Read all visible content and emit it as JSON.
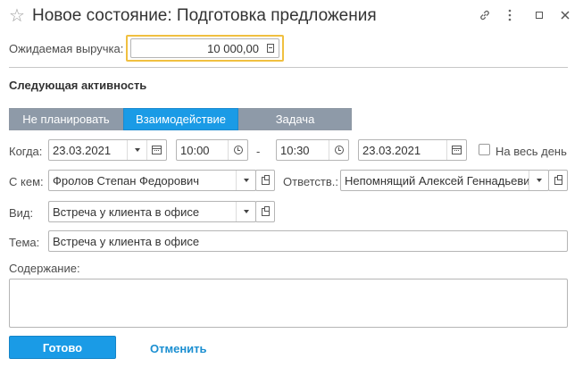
{
  "window": {
    "title": "Новое состояние: Подготовка предложения"
  },
  "revenue": {
    "label": "Ожидаемая выручка:",
    "value": "10 000,00"
  },
  "section": {
    "title": "Следующая активность"
  },
  "activity_tabs": [
    {
      "label": "Не планировать",
      "selected": false
    },
    {
      "label": "Взаимодействие",
      "selected": true
    },
    {
      "label": "Задача",
      "selected": false
    }
  ],
  "when": {
    "label": "Когда:",
    "start_date": "23.03.2021",
    "start_time": "10:00",
    "dash": "-",
    "end_time": "10:30",
    "end_date": "23.03.2021",
    "all_day_label": "На весь день",
    "all_day_checked": false
  },
  "with": {
    "label": "С кем:",
    "value": "Фролов Степан Федорович"
  },
  "responsible": {
    "label": "Ответств.:",
    "value": "Непомнящий Алексей Геннадьевич"
  },
  "kind": {
    "label": "Вид:",
    "value": "Встреча у клиента в офисе"
  },
  "subject": {
    "label": "Тема:",
    "value": "Встреча у клиента в офисе"
  },
  "content": {
    "label": "Содержание:",
    "value": ""
  },
  "footer": {
    "done_label": "Готово",
    "cancel_label": "Отменить"
  },
  "colors": {
    "primary": "#1a9be6",
    "tab_inactive": "#8e9aa8",
    "highlight_border": "#f0c040",
    "cancel_link": "#1b8fd1"
  }
}
